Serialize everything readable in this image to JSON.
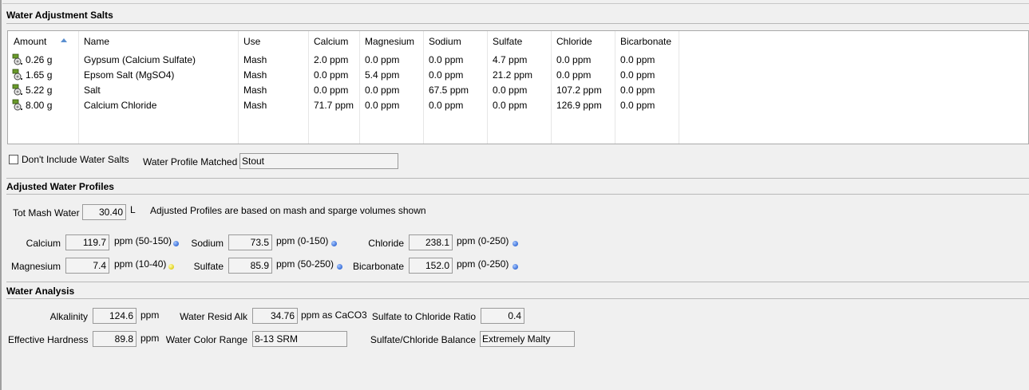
{
  "sections": {
    "salts": "Water Adjustment Salts",
    "adjusted": "Adjusted Water Profiles",
    "analysis": "Water Analysis"
  },
  "salts_table": {
    "columns": [
      "Amount",
      "Name",
      "Use",
      "Calcium",
      "Magnesium",
      "Sodium",
      "Sulfate",
      "Chloride",
      "Bicarbonate"
    ],
    "sort_icon": "sort-ascending-icon",
    "row_icon": "water-salt-icon",
    "rows": [
      {
        "amount": "0.26 g",
        "name": "Gypsum (Calcium Sulfate)",
        "use": "Mash",
        "calcium": "2.0 ppm",
        "magnesium": "0.0 ppm",
        "sodium": "0.0 ppm",
        "sulfate": "4.7 ppm",
        "chloride": "0.0 ppm",
        "bicarbonate": "0.0 ppm"
      },
      {
        "amount": "1.65 g",
        "name": "Epsom Salt (MgSO4)",
        "use": "Mash",
        "calcium": "0.0 ppm",
        "magnesium": "5.4 ppm",
        "sodium": "0.0 ppm",
        "sulfate": "21.2 ppm",
        "chloride": "0.0 ppm",
        "bicarbonate": "0.0 ppm"
      },
      {
        "amount": "5.22 g",
        "name": "Salt",
        "use": "Mash",
        "calcium": "0.0 ppm",
        "magnesium": "0.0 ppm",
        "sodium": "67.5 ppm",
        "sulfate": "0.0 ppm",
        "chloride": "107.2 ppm",
        "bicarbonate": "0.0 ppm"
      },
      {
        "amount": "8.00 g",
        "name": "Calcium Chloride",
        "use": "Mash",
        "calcium": "71.7 ppm",
        "magnesium": "0.0 ppm",
        "sodium": "0.0 ppm",
        "sulfate": "0.0 ppm",
        "chloride": "126.9 ppm",
        "bicarbonate": "0.0 ppm"
      }
    ]
  },
  "options": {
    "dont_include_label": "Don't Include Water Salts",
    "dont_include_checked": false,
    "profile_matched_label": "Water Profile Matched",
    "profile_matched_value": "Stout"
  },
  "adjusted": {
    "tot_mash_label": "Tot Mash Water",
    "tot_mash_value": "30.40",
    "tot_mash_unit": "L",
    "note": "Adjusted Profiles are based on mash and sparge volumes shown",
    "ions": {
      "calcium": {
        "label": "Calcium",
        "value": "119.7",
        "range": "ppm (50-150)",
        "status_color": "#3a6fd8"
      },
      "magnesium": {
        "label": "Magnesium",
        "value": "7.4",
        "range": "ppm (10-40)",
        "status_color": "#e0d020"
      },
      "sodium": {
        "label": "Sodium",
        "value": "73.5",
        "range": "ppm (0-150)",
        "status_color": "#3a6fd8"
      },
      "sulfate": {
        "label": "Sulfate",
        "value": "85.9",
        "range": "ppm (50-250)",
        "status_color": "#3a6fd8"
      },
      "chloride": {
        "label": "Chloride",
        "value": "238.1",
        "range": "ppm (0-250)",
        "status_color": "#3a6fd8"
      },
      "bicarbonate": {
        "label": "Bicarbonate",
        "value": "152.0",
        "range": "ppm (0-250)",
        "status_color": "#3a6fd8"
      }
    }
  },
  "analysis": {
    "alkalinity_label": "Alkalinity",
    "alkalinity_value": "124.6",
    "alkalinity_unit": "ppm",
    "hardness_label": "Effective Hardness",
    "hardness_value": "89.8",
    "hardness_unit": "ppm",
    "resid_alk_label": "Water Resid Alk",
    "resid_alk_value": "34.76",
    "resid_alk_unit": "ppm as CaCO3",
    "color_range_label": "Water Color Range",
    "color_range_value": "8-13 SRM",
    "ratio_label": "Sulfate to Chloride Ratio",
    "ratio_value": "0.4",
    "balance_label": "Sulfate/Chloride Balance",
    "balance_value": "Extremely Malty"
  }
}
